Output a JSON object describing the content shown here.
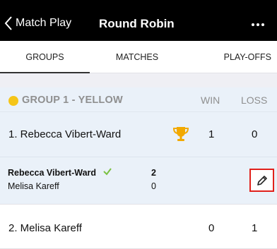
{
  "nav": {
    "back_label": "Match Play",
    "title": "Round Robin",
    "more_icon": "more-icon"
  },
  "tabs": [
    {
      "label": "GROUPS",
      "active": true
    },
    {
      "label": "MATCHES",
      "active": false
    },
    {
      "label": "PLAY-OFFS",
      "active": false
    }
  ],
  "group": {
    "title": "GROUP 1 - YELLOW",
    "color": "#f5c518",
    "columns": {
      "win": "WIN",
      "loss": "LOSS"
    },
    "players": [
      {
        "name": "1. Rebecca Vibert-Ward",
        "win": "1",
        "loss": "0",
        "trophy": true
      },
      {
        "name": "2. Melisa Kareff",
        "win": "0",
        "loss": "1",
        "trophy": false
      }
    ],
    "match": {
      "player1": "Rebecca Vibert-Ward",
      "player1_score": "2",
      "player2": "Melisa Kareff",
      "player2_score": "0",
      "winner_icon": "check-icon",
      "edit_icon": "pencil-icon"
    }
  },
  "colors": {
    "accent_highlight": "#e0201b",
    "header_bg": "#000000",
    "row_bg": "#eaf1f9",
    "check": "#7bc142",
    "trophy": "#f2a900"
  }
}
